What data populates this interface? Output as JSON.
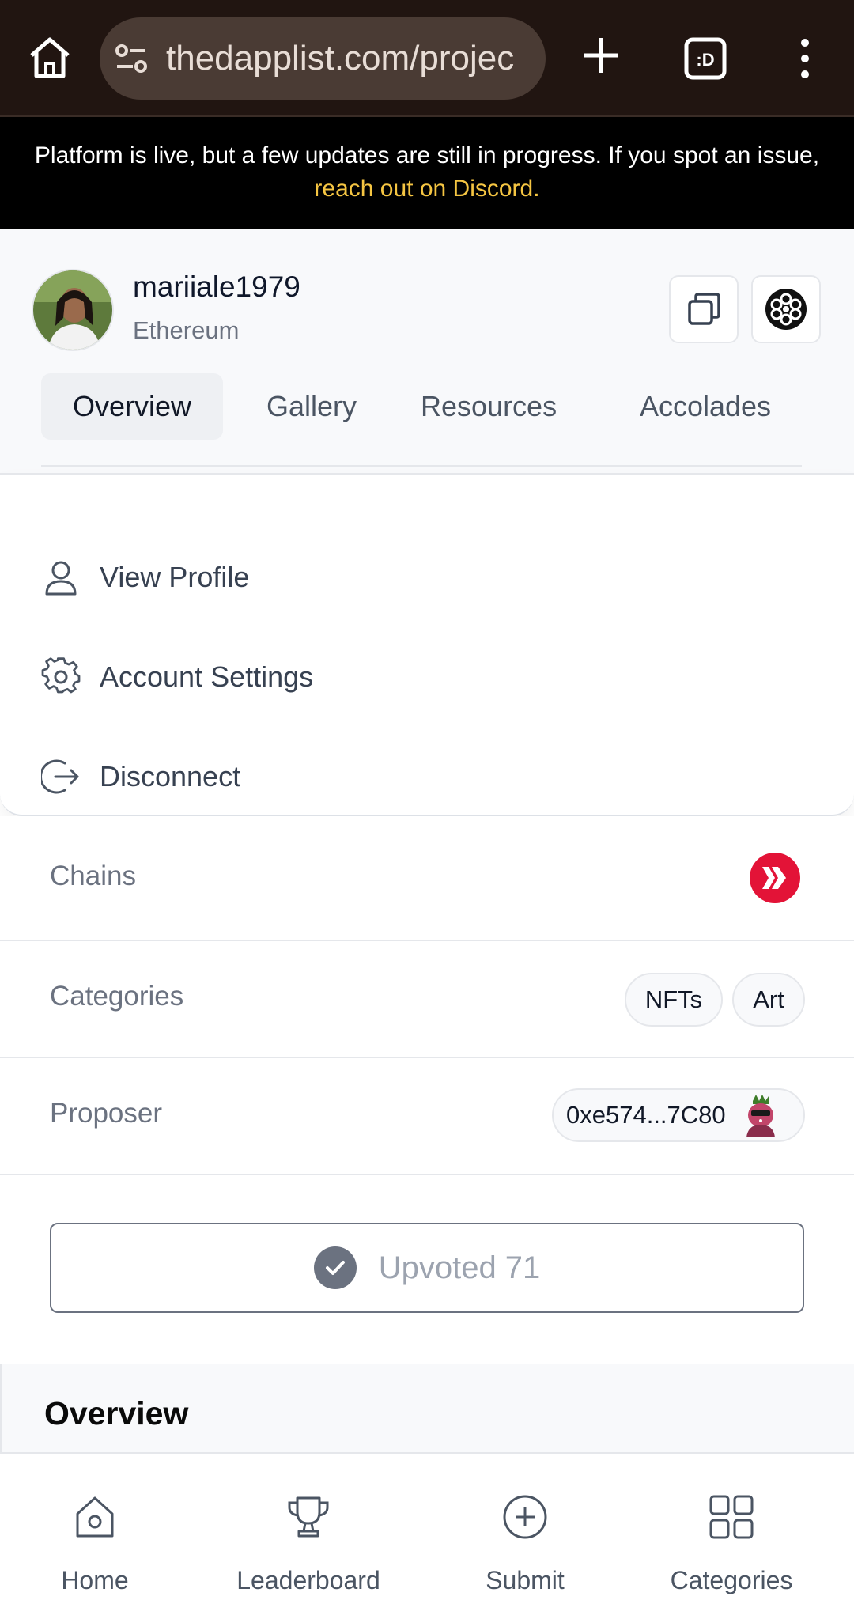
{
  "browser": {
    "url": "thedapplist.com/projec",
    "tab_label": ":D"
  },
  "banner": {
    "text": "Platform is live, but a few updates are still in progress. If you spot an issue, ",
    "link_text": "reach out on Discord."
  },
  "project": {
    "name": "mariiale1979",
    "chain": "Ethereum"
  },
  "tabs": [
    {
      "label": "Overview"
    },
    {
      "label": "Gallery"
    },
    {
      "label": "Resources"
    },
    {
      "label": "Accolades"
    }
  ],
  "menu": {
    "items": [
      {
        "label": "View Profile",
        "icon": "user-icon"
      },
      {
        "label": "Account Settings",
        "icon": "gear-icon"
      },
      {
        "label": "Disconnect",
        "icon": "logout-icon"
      }
    ]
  },
  "details": {
    "chains_label": "Chains",
    "categories_label": "Categories",
    "categories": [
      "NFTs",
      "Art"
    ],
    "proposer_label": "Proposer",
    "proposer_address": "0xe574...7C80"
  },
  "upvote": {
    "label": "Upvoted 71"
  },
  "overview": {
    "title": "Overview"
  },
  "bottom_nav": [
    {
      "label": "Home",
      "icon": "home-icon"
    },
    {
      "label": "Leaderboard",
      "icon": "trophy-icon"
    },
    {
      "label": "Submit",
      "icon": "plus-circle-icon"
    },
    {
      "label": "Categories",
      "icon": "grid-icon"
    }
  ],
  "colors": {
    "chrome_bg": "#211511",
    "banner_link": "#f5c542",
    "hive_red": "#e31337"
  }
}
